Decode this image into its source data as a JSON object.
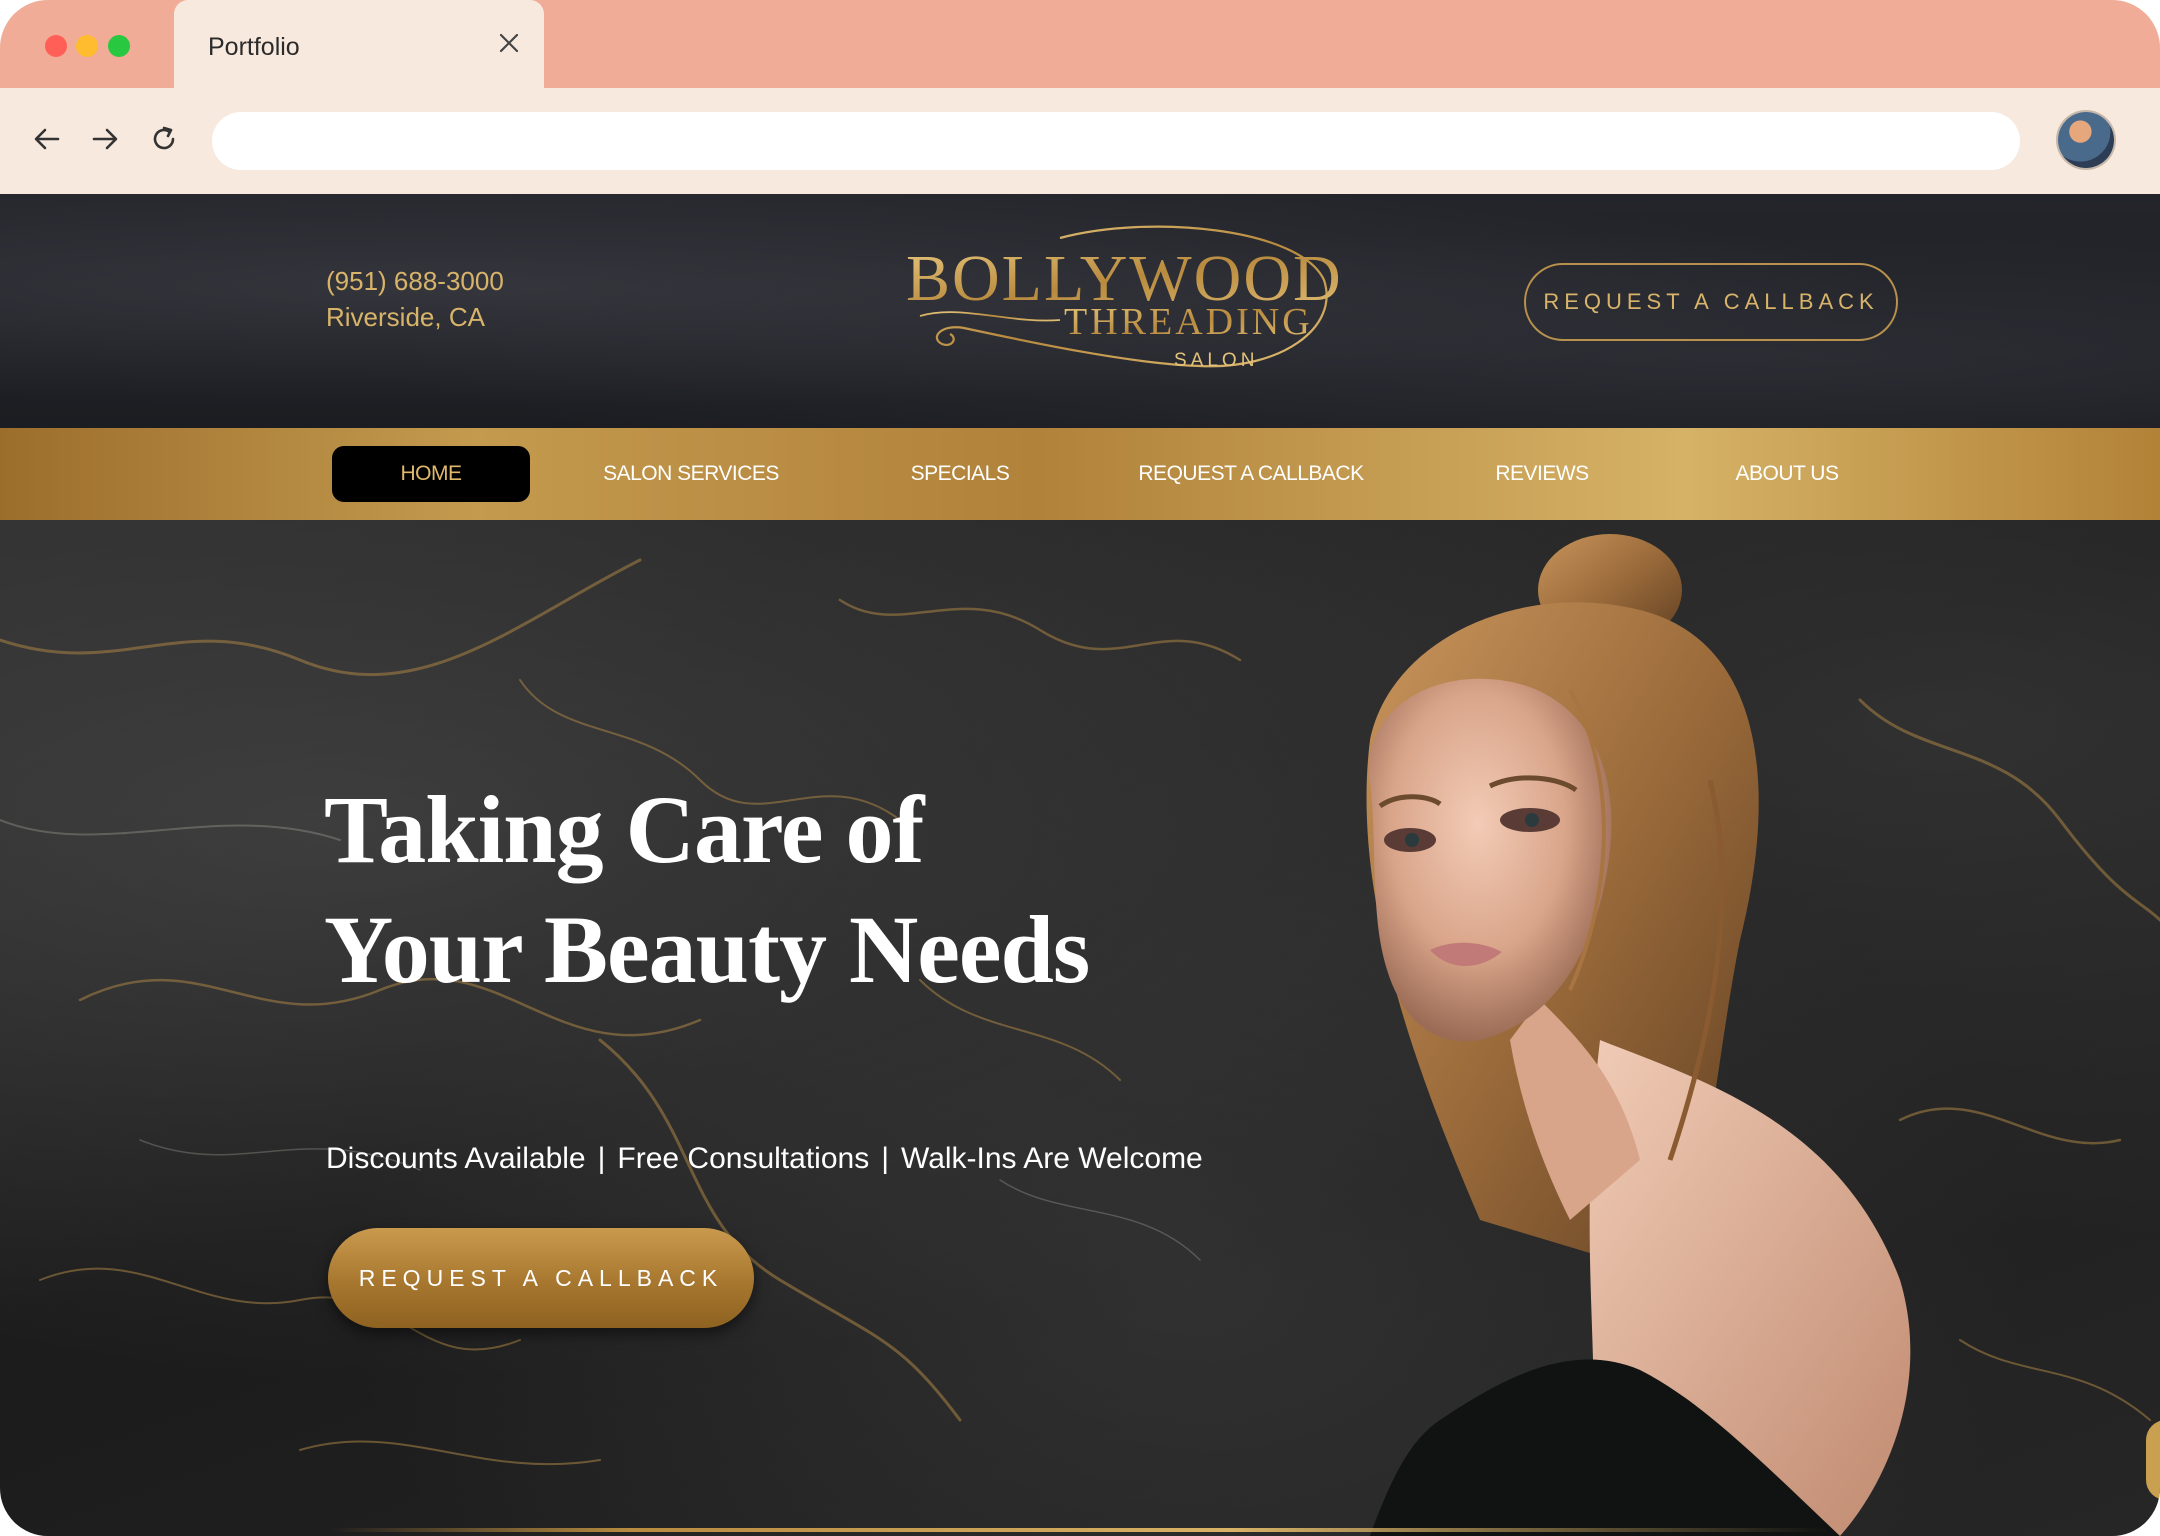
{
  "browser": {
    "tab_title": "Portfolio",
    "address_value": "",
    "icons": {
      "close": "close-icon",
      "back": "arrow-left-icon",
      "forward": "arrow-right-icon",
      "reload": "reload-icon",
      "profile": "avatar"
    }
  },
  "header": {
    "phone": "(951) 688-3000",
    "city": "Riverside, CA",
    "logo": {
      "line1": "BOLLYWOOD",
      "line2": "THREADING",
      "line3": "SALON"
    },
    "cta_label": "REQUEST A CALLBACK"
  },
  "nav": {
    "items": [
      {
        "label": "HOME",
        "active": true
      },
      {
        "label": "SALON SERVICES",
        "active": false
      },
      {
        "label": "SPECIALS",
        "active": false
      },
      {
        "label": "REQUEST A CALLBACK",
        "active": false
      },
      {
        "label": "REVIEWS",
        "active": false
      },
      {
        "label": "ABOUT US",
        "active": false
      }
    ]
  },
  "hero": {
    "title_line1": "Taking Care of",
    "title_line2": "Your Beauty Needs",
    "features": [
      "Discounts Available",
      "Free Consultations",
      "Walk-Ins Are Welcome"
    ],
    "separator": "|",
    "cta_label": "REQUEST A CALLBACK"
  },
  "colors": {
    "chrome_tabbar": "#f0ac97",
    "chrome_toolbar": "#f8e9de",
    "gold": "#d7b46a",
    "gold_dark": "#a7772f",
    "header_bg": "#1f2025"
  }
}
